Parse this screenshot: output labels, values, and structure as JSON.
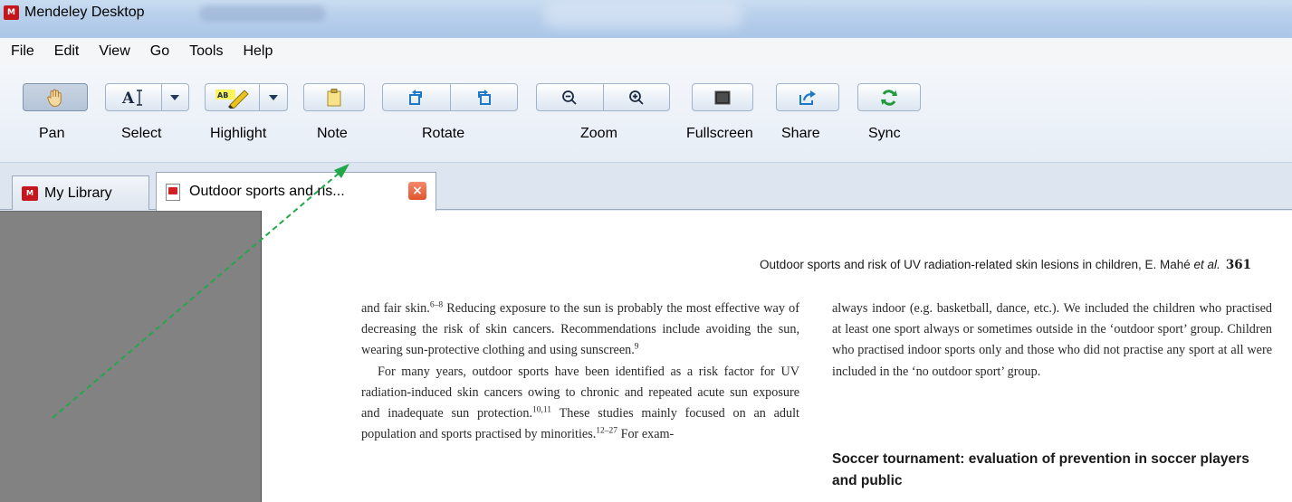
{
  "window": {
    "app_title": "Mendeley Desktop",
    "logo_text": "M"
  },
  "menu": {
    "items": [
      "File",
      "Edit",
      "View",
      "Go",
      "Tools",
      "Help"
    ]
  },
  "toolbar": {
    "pan_label": "Pan",
    "select_label": "Select",
    "highlight_label": "Highlight",
    "note_label": "Note",
    "rotate_label": "Rotate",
    "zoom_label": "Zoom",
    "fullscreen_label": "Fullscreen",
    "share_label": "Share",
    "sync_label": "Sync",
    "pan_active": true,
    "sync_color": "#1f9a3c",
    "rotate_color": "#1e78c8"
  },
  "tabs": [
    {
      "label": "My Library",
      "icon": "mendeley-logo-icon",
      "active": false
    },
    {
      "label": "Outdoor sports and ris...",
      "icon": "pdf-icon",
      "active": true,
      "closable": true
    }
  ],
  "document": {
    "running_head_text": "Outdoor sports and risk of UV radiation-related skin lesions in children, E. Mahé ",
    "running_head_etal": "et al.",
    "page_number": "361",
    "left_column": {
      "p1_a": "and fair skin.",
      "p1_sup1": "6–8",
      "p1_b": " Reducing exposure to the sun is probably the most effective way of decreasing the risk of skin cancers. Recommendations include avoiding the sun, wearing sun-protective clothing and using sunscreen.",
      "p1_sup2": "9",
      "p2_a": "For many years, outdoor sports have been identified as a risk factor for UV radiation-induced skin cancers owing to chronic and repeated acute sun exposure and inadequate sun protection.",
      "p2_sup1": "10,11",
      "p2_b": " These studies mainly focused on an adult population and sports practised by minorities.",
      "p2_sup2": "12–27",
      "p2_c": " For exam-"
    },
    "right_column": {
      "p1": "always indoor (e.g. basketball, dance, etc.). We included the children who practised at least one sport always or sometimes outside in the ‘outdoor sport’ group. Children who practised indoor sports only and those who did not practise any sport at all were included in the ‘no outdoor sport’ group."
    },
    "section_heading": "Soccer tournament: evaluation of prevention in soccer players and public"
  },
  "annotation": {
    "arrow_color": "#22a84a"
  }
}
